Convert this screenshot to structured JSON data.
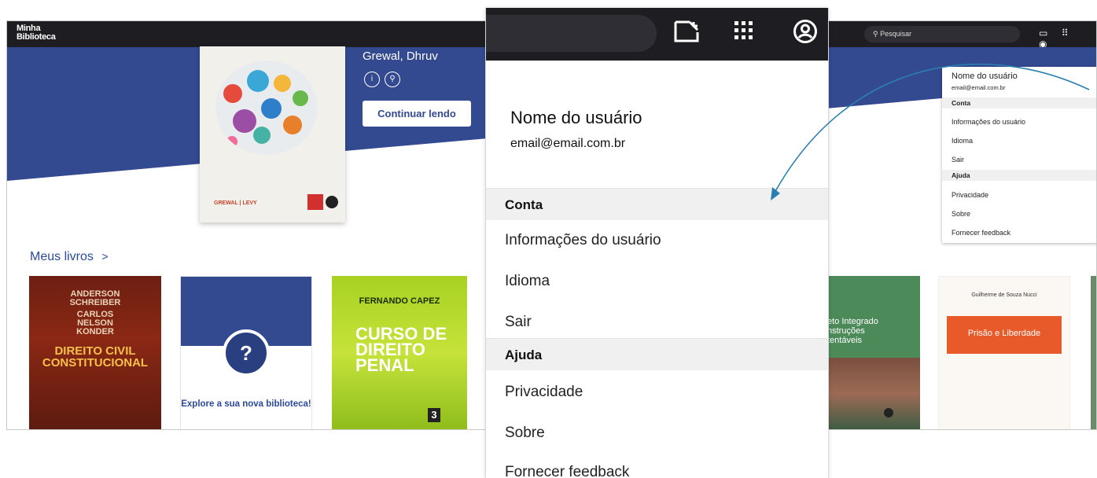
{
  "app": {
    "logo_line1": "Minha",
    "logo_line2": "Biblioteca",
    "search_placeholder": "Pesquisar"
  },
  "hero": {
    "author": "Grewal, Dhruv",
    "cover_authors": "GREWAL | LEVY",
    "continue_label": "Continuar lendo"
  },
  "shelf": {
    "title": "Meus livros",
    "chevron": ">",
    "books": [
      {
        "authors": [
          "ANDERSON",
          "SCHREIBER",
          "CARLOS",
          "NELSON",
          "KONDER"
        ],
        "title": "DIREITO CIVIL CONSTITUCIONAL"
      },
      {
        "explore_label": "Explore a sua nova biblioteca!",
        "explore_icon": "?"
      },
      {
        "author": "FERNANDO CAPEZ",
        "title": "CURSO DE DIREITO PENAL",
        "volume": "3"
      },
      {
        "title": "eto Integrado nstruções tentáveis"
      },
      {
        "author": "Guilherme de Souza Nucci",
        "title": "Prisão e Liberdade"
      }
    ]
  },
  "user_menu": {
    "name": "Nome do usuário",
    "email": "email@email.com.br",
    "section_account": "Conta",
    "item_user_info": "Informações do usuário",
    "item_language": "Idioma",
    "item_logout": "Sair",
    "section_help": "Ajuda",
    "item_privacy": "Privacidade",
    "item_about": "Sobre",
    "item_feedback": "Fornecer feedback"
  },
  "icons": [
    "info-icon",
    "search-icon",
    "tablet-icon",
    "apps-grid-icon",
    "account-circle-icon"
  ],
  "colors": {
    "topbar": "#1d1d22",
    "brand_blue": "#344a90",
    "link_blue": "#2c4a9a",
    "arrow": "#2b7fb0"
  }
}
